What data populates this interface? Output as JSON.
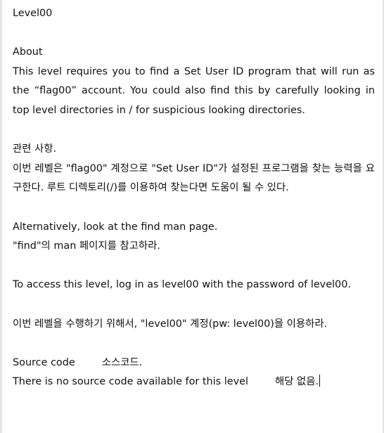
{
  "document": {
    "title": "Level00",
    "about_heading": "About",
    "about_text": "This level requires you to find a Set User ID program that will run as the “flag00” account. You could also find this by carefully looking in top level directories in / for suspicious looking directories.",
    "korean_heading": "관련 사항.",
    "korean_text": "이번 레벨은 \"flag00\" 계정으로 \"Set User ID\"가 설정된 프로그램을 찾는 능력을 요구한다. 루트 디렉토리(/)를 이용하여 찾는다면 도움이 될 수 있다.",
    "alt_text": "Alternatively, look at the find man page.",
    "alt_text_korean": "\"find\"의 man 페이지를 참고하라.",
    "access_text": "To access this level, log in as level00 with the password of lev­el00.",
    "access_text_korean": "이번 레벨을 수행하기 위해서, \"level00\" 계정(pw: level00)을 이용하라.",
    "source_heading": "Source code",
    "source_heading_korean": "소스코드.",
    "source_text": "There is no source code available for this level",
    "source_text_korean": "해당 없음."
  }
}
